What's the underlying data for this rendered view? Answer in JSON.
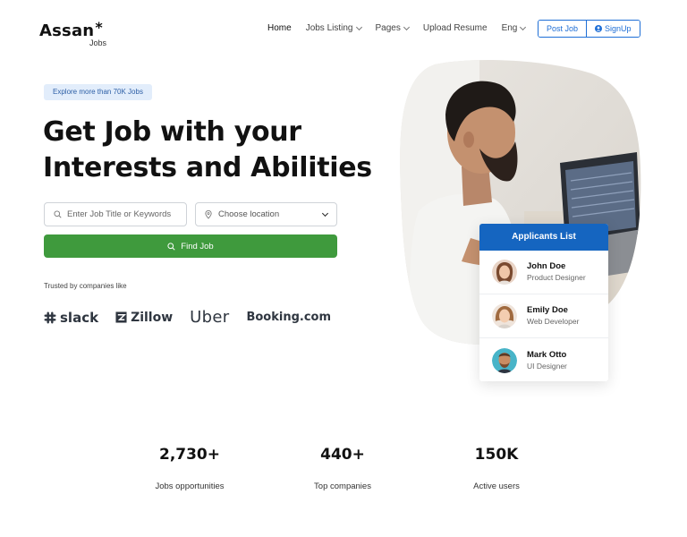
{
  "brand": {
    "name": "Assan",
    "star": "*",
    "sub": "Jobs"
  },
  "nav": {
    "items": [
      {
        "label": "Home",
        "dropdown": false,
        "active": true
      },
      {
        "label": "Jobs Listing",
        "dropdown": true,
        "active": false
      },
      {
        "label": "Pages",
        "dropdown": true,
        "active": false
      },
      {
        "label": "Upload Resume",
        "dropdown": false,
        "active": false
      },
      {
        "label": "Eng",
        "dropdown": true,
        "active": false
      }
    ],
    "post_job": "Post Job",
    "signup": "SignUp"
  },
  "hero": {
    "badge": "Explore more than 70K Jobs",
    "title_line1": "Get Job with your",
    "title_line2": "Interests and Abilities",
    "search_placeholder": "Enter Job Title or Keywords",
    "location_label": "Choose location",
    "find_button": "Find Job",
    "trusted_text": "Trusted by companies like",
    "companies": [
      "slack",
      "Zillow",
      "Uber",
      "Booking.com"
    ]
  },
  "applicants": {
    "title": "Applicants List",
    "items": [
      {
        "name": "John Doe",
        "role": "Product Designer"
      },
      {
        "name": "Emily Doe",
        "role": "Web Developer"
      },
      {
        "name": "Mark Otto",
        "role": "UI Designer"
      }
    ]
  },
  "stats": [
    {
      "value": "2,730+",
      "label": "Jobs opportunities"
    },
    {
      "value": "440+",
      "label": "Top companies"
    },
    {
      "value": "150K",
      "label": "Active users"
    }
  ],
  "colors": {
    "primary": "#1e6ed6",
    "card_header": "#1565c0",
    "find_button": "#3f9a3d",
    "badge_bg": "#e2edfb"
  }
}
